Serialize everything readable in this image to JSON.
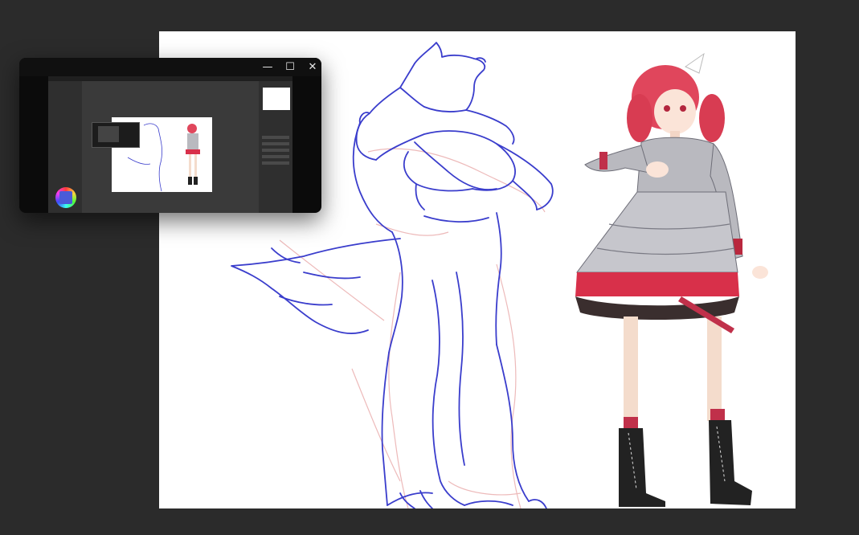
{
  "window": {
    "title": "",
    "controls": {
      "minimize_glyph": "—",
      "maximize_glyph": "☐",
      "close_glyph": "✕"
    }
  },
  "colors": {
    "desktop_background": "#2b2b2b",
    "canvas_background": "#ffffff",
    "sketch_stroke": "#3a3dcc",
    "underdrawing_stroke": "#e9a9a9",
    "hair_red": "#e0465c",
    "skirt_red": "#d8304a",
    "coat_gray": "#b9b9bf"
  },
  "icons": [
    "minimize-icon",
    "maximize-icon",
    "close-icon",
    "color-wheel-icon"
  ]
}
